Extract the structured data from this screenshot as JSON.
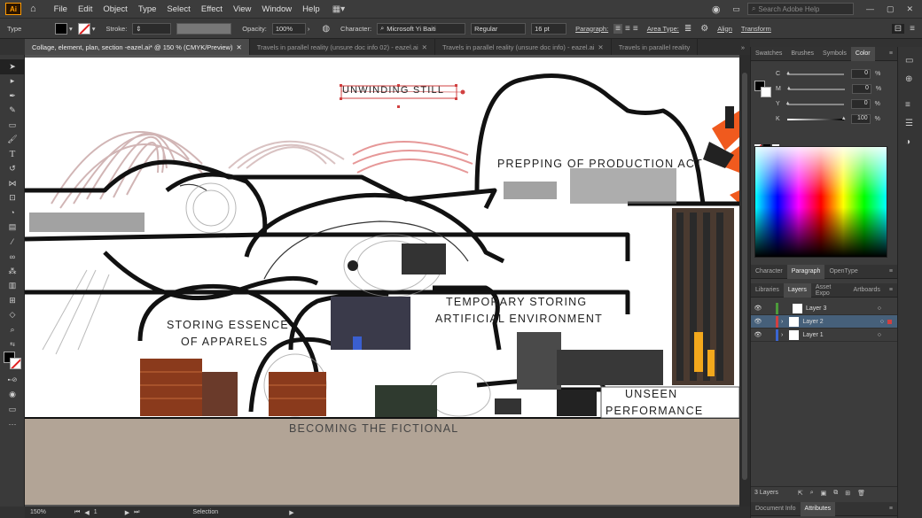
{
  "app": {
    "logo": "Ai"
  },
  "menu": [
    "File",
    "Edit",
    "Object",
    "Type",
    "Select",
    "Effect",
    "View",
    "Window",
    "Help"
  ],
  "search_placeholder": "Search Adobe Help",
  "control": {
    "type_label": "Type",
    "stroke_label": "Stroke:",
    "opacity_label": "Opacity:",
    "opacity_value": "100%",
    "character_label": "Character:",
    "font_family": "Microsoft Yi Baiti",
    "font_style": "Regular",
    "font_size": "16 pt",
    "paragraph_label": "Paragraph:",
    "area_type_label": "Area Type:",
    "align_label": "Align",
    "transform_label": "Transform"
  },
  "tabs": [
    "Collage, element, plan, section -eazel.ai* @ 150 % (CMYK/Preview)",
    "Travels in parallel reality (unsure doc info 02) - eazel.ai",
    "Travels in parallel reality (unsure doc info) - eazel.ai",
    "Travels in parallel reality"
  ],
  "artwork": {
    "labels": {
      "unwinding": "UNWINDING STILL",
      "prepping": "PREPPING OF PRODUCTION ACT",
      "temporary1": "TEMPORARY STORING",
      "temporary2": "ARTIFICIAL ENVIRONMENT",
      "storing1": "STORING ESSENCE",
      "storing2": "OF APPARELS",
      "unseen1": "UNSEEN",
      "unseen2": "PERFORMANCE",
      "becoming": "BECOMING THE FICTIONAL"
    }
  },
  "status": {
    "zoom": "150%",
    "page": "1",
    "mode": "Selection"
  },
  "color_panel": {
    "tabs": [
      "Swatches",
      "Brushes",
      "Symbols",
      "Color"
    ],
    "channels": [
      {
        "name": "C",
        "value": "0",
        "pct": 0
      },
      {
        "name": "M",
        "value": "0",
        "pct": 0
      },
      {
        "name": "Y",
        "value": "0",
        "pct": 0
      },
      {
        "name": "K",
        "value": "100",
        "pct": 100
      }
    ],
    "unit": "%"
  },
  "para_tabs": [
    "Character",
    "Paragraph",
    "OpenType"
  ],
  "layers_panel": {
    "tabs": [
      "Libraries",
      "Layers",
      "Asset Expo",
      "Artboards"
    ],
    "layers": [
      {
        "name": "Layer 3",
        "color": "#4c9a3a"
      },
      {
        "name": "Layer 2",
        "color": "#d24040"
      },
      {
        "name": "Layer 1",
        "color": "#3a66d2"
      }
    ],
    "count": "3 Layers"
  },
  "bottom_tabs": [
    "Document Info",
    "Attributes"
  ],
  "icons": [
    "home-icon",
    "selection-tool-icon",
    "direct-selection-icon",
    "pen-tool-icon",
    "curvature-icon",
    "rectangle-tool-icon",
    "paintbrush-icon",
    "type-tool-icon",
    "rotate-icon",
    "width-tool-icon",
    "free-transform-icon",
    "shape-builder-icon",
    "gradient-icon",
    "eyedropper-icon",
    "blend-icon",
    "symbol-sprayer-icon",
    "column-graph-icon",
    "artboard-icon",
    "slice-icon",
    "hand-icon",
    "zoom-icon",
    "fill-stroke-icon",
    "draw-mode-icon",
    "screen-mode-icon",
    "more-tools-icon"
  ]
}
